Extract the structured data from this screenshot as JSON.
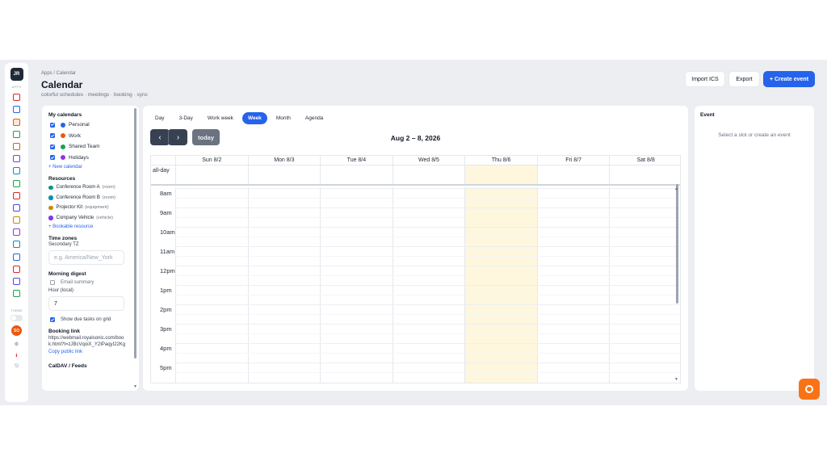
{
  "app": {
    "breadcrumb": "Apps / Calendar",
    "title": "Calendar",
    "subtitle": "colorful schedules · meetings · booking · sync"
  },
  "rail": {
    "avatar": "JR",
    "apps_label": "APPS",
    "icons": [
      {
        "name": "mail-icon",
        "color": "#dc2626"
      },
      {
        "name": "contacts-icon",
        "color": "#2563eb"
      },
      {
        "name": "calendar-icon",
        "color": "#ea580c"
      },
      {
        "name": "tasks-icon",
        "color": "#16a34a"
      },
      {
        "name": "bell-icon",
        "color": "#ea580c"
      },
      {
        "name": "home-icon",
        "color": "#7c3aed"
      },
      {
        "name": "cloud-icon",
        "color": "#0891b2"
      },
      {
        "name": "lock-icon",
        "color": "#16a34a"
      },
      {
        "name": "people-icon",
        "color": "#dc2626"
      },
      {
        "name": "document-icon",
        "color": "#4f46e5"
      },
      {
        "name": "note-icon",
        "color": "#ca8a04"
      },
      {
        "name": "image-icon",
        "color": "#9333ea"
      },
      {
        "name": "card-icon",
        "color": "#0891b2"
      },
      {
        "name": "chart-icon",
        "color": "#2563eb"
      },
      {
        "name": "clock-icon",
        "color": "#dc2626"
      },
      {
        "name": "grid-icon",
        "color": "#4f46e5"
      },
      {
        "name": "list-icon",
        "color": "#16a34a"
      }
    ],
    "theme_label": "THEME",
    "user_initials": "SO"
  },
  "header": {
    "import_label": "Import ICS",
    "export_label": "Export",
    "create_label": "+ Create event"
  },
  "sidebar": {
    "calendars_title": "My calendars",
    "calendars": [
      {
        "label": "Personal",
        "color": "#2563eb"
      },
      {
        "label": "Work",
        "color": "#ea580c"
      },
      {
        "label": "Shared Team",
        "color": "#16a34a"
      },
      {
        "label": "Holidays",
        "color": "#9333ea"
      }
    ],
    "new_calendar": "+ New calendar",
    "resources_title": "Resources",
    "resources": [
      {
        "label": "Conference Room A",
        "type": "(room)",
        "color": "#0d9488"
      },
      {
        "label": "Conference Room B",
        "type": "(room)",
        "color": "#0891b2"
      },
      {
        "label": "Projector Kit",
        "type": "(equipment)",
        "color": "#ca8a04"
      },
      {
        "label": "Company Vehicle",
        "type": "(vehicle)",
        "color": "#7c3aed"
      }
    ],
    "bookable_resource": "+ Bookable resource",
    "timezones_title": "Time zones",
    "secondary_tz_label": "Secondary TZ",
    "tz_placeholder": "e.g. America/New_York",
    "digest_title": "Morning digest",
    "email_summary": "Email summary",
    "hour_label": "Hour (local)",
    "hour_value": "7",
    "show_due": "Show due tasks on grid",
    "booking_title": "Booking link",
    "booking_url": "https://webmail.royalsonic.com/book.html?t=zJBcVqoiX_Y2IPaqyI22Kg",
    "copy_link": "Copy public link",
    "caldav_title": "CalDAV / Feeds"
  },
  "views": [
    "Day",
    "3-Day",
    "Work week",
    "Week",
    "Month",
    "Agenda"
  ],
  "active_view": "Week",
  "range_title": "Aug 2 – 8, 2026",
  "nav": {
    "today": "today",
    "prev": "‹",
    "next": "›"
  },
  "days": [
    "Sun 8/2",
    "Mon 8/3",
    "Tue 8/4",
    "Wed 8/5",
    "Thu 8/6",
    "Fri 8/7",
    "Sat 8/8"
  ],
  "today_index": 4,
  "allday_label": "all-day",
  "hours": [
    "8am",
    "9am",
    "10am",
    "11am",
    "12pm",
    "1pm",
    "2pm",
    "3pm",
    "4pm",
    "5pm"
  ],
  "event_panel": {
    "title": "Event",
    "empty": "Select a slot or create an event"
  }
}
